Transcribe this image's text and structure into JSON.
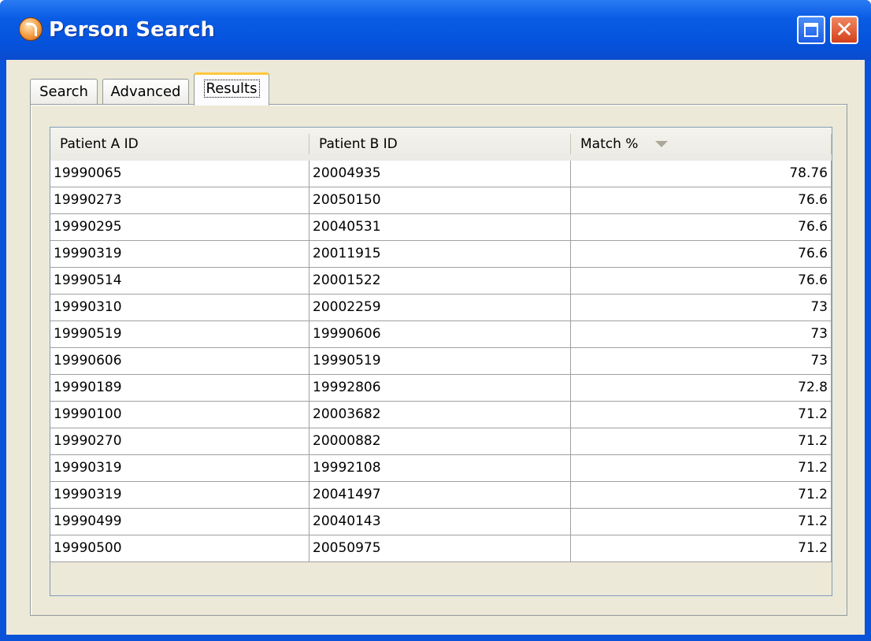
{
  "window": {
    "title": "Person Search"
  },
  "tabs": [
    {
      "label": "Search"
    },
    {
      "label": "Advanced"
    },
    {
      "label": "Results",
      "selected": true
    }
  ],
  "table": {
    "columns": [
      "Patient A ID",
      "Patient B ID",
      "Match %"
    ],
    "sort_column": "Match %",
    "sort_direction": "descending",
    "rows": [
      {
        "a": "19990065",
        "b": "20004935",
        "match": "78.76"
      },
      {
        "a": "19990273",
        "b": "20050150",
        "match": "76.6"
      },
      {
        "a": "19990295",
        "b": "20040531",
        "match": "76.6"
      },
      {
        "a": "19990319",
        "b": "20011915",
        "match": "76.6"
      },
      {
        "a": "19990514",
        "b": "20001522",
        "match": "76.6"
      },
      {
        "a": "19990310",
        "b": "20002259",
        "match": "73"
      },
      {
        "a": "19990519",
        "b": "19990606",
        "match": "73"
      },
      {
        "a": "19990606",
        "b": "19990519",
        "match": "73"
      },
      {
        "a": "19990189",
        "b": "19992806",
        "match": "72.8"
      },
      {
        "a": "19990100",
        "b": "20003682",
        "match": "71.2"
      },
      {
        "a": "19990270",
        "b": "20000882",
        "match": "71.2"
      },
      {
        "a": "19990319",
        "b": "19992108",
        "match": "71.2"
      },
      {
        "a": "19990319",
        "b": "20041497",
        "match": "71.2"
      },
      {
        "a": "19990499",
        "b": "20040143",
        "match": "71.2"
      },
      {
        "a": "19990500",
        "b": "20050975",
        "match": "71.2"
      }
    ]
  }
}
